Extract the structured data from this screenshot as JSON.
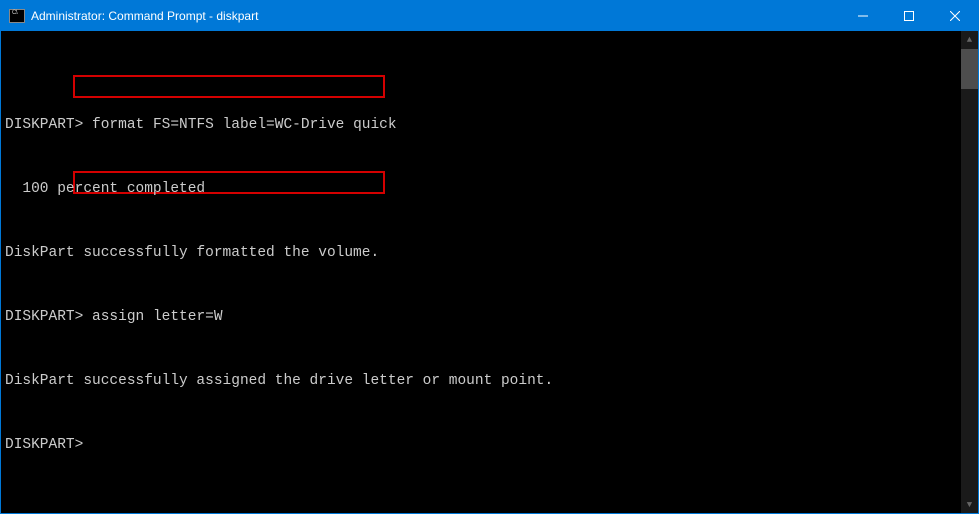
{
  "titlebar": {
    "icon_text": "C:\\",
    "title": "Administrator: Command Prompt - diskpart"
  },
  "terminal": {
    "line1_prompt": "DISKPART>",
    "line1_cmd": " format FS=NTFS label=WC-Drive quick",
    "line2": "  100 percent completed",
    "line3": "DiskPart successfully formatted the volume.",
    "line4_prompt": "DISKPART>",
    "line4_cmd": " assign letter=W",
    "line5": "DiskPart successfully assigned the drive letter or mount point.",
    "line6": "DISKPART>"
  }
}
